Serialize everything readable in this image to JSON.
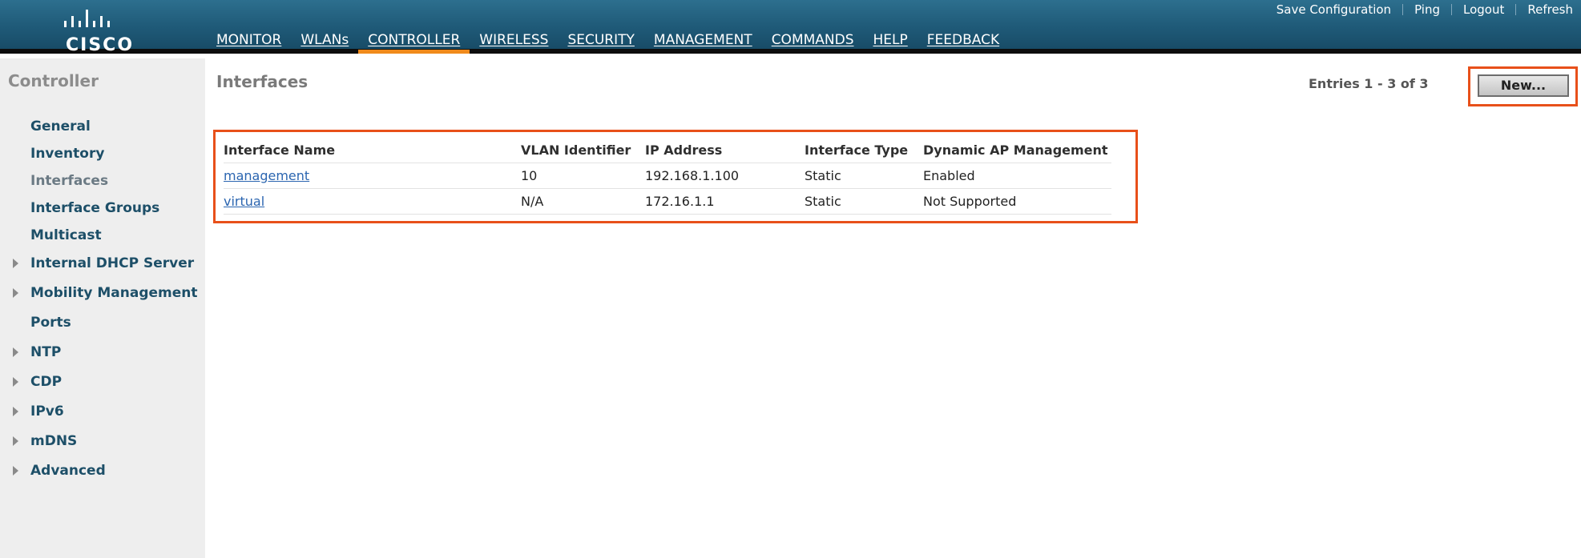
{
  "header": {
    "brand": "CISCO",
    "top_links": [
      "Save Configuration",
      "Ping",
      "Logout",
      "Refresh"
    ],
    "nav": [
      {
        "label": "MONITOR",
        "active": false
      },
      {
        "label": "WLANs",
        "active": false
      },
      {
        "label": "CONTROLLER",
        "active": true
      },
      {
        "label": "WIRELESS",
        "active": false
      },
      {
        "label": "SECURITY",
        "active": false
      },
      {
        "label": "MANAGEMENT",
        "active": false
      },
      {
        "label": "COMMANDS",
        "active": false
      },
      {
        "label": "HELP",
        "active": false
      },
      {
        "label": "FEEDBACK",
        "active": false
      }
    ]
  },
  "sidebar": {
    "title": "Controller",
    "items": [
      {
        "label": "General",
        "expandable": false,
        "active": false
      },
      {
        "label": "Inventory",
        "expandable": false,
        "active": false
      },
      {
        "label": "Interfaces",
        "expandable": false,
        "active": true
      },
      {
        "label": "Interface Groups",
        "expandable": false,
        "active": false
      },
      {
        "label": "Multicast",
        "expandable": false,
        "active": false
      },
      {
        "label": "Internal DHCP Server",
        "expandable": true,
        "active": false
      },
      {
        "label": "Mobility Management",
        "expandable": true,
        "active": false
      },
      {
        "label": "Ports",
        "expandable": false,
        "active": false
      },
      {
        "label": "NTP",
        "expandable": true,
        "active": false
      },
      {
        "label": "CDP",
        "expandable": true,
        "active": false
      },
      {
        "label": "IPv6",
        "expandable": true,
        "active": false
      },
      {
        "label": "mDNS",
        "expandable": true,
        "active": false
      },
      {
        "label": "Advanced",
        "expandable": true,
        "active": false
      }
    ]
  },
  "main": {
    "title": "Interfaces",
    "entries": "Entries 1 - 3 of 3",
    "new_button": "New...",
    "table": {
      "headers": [
        "Interface Name",
        "VLAN Identifier",
        "IP Address",
        "Interface Type",
        "Dynamic AP Management"
      ],
      "rows": [
        [
          "management",
          "10",
          "192.168.1.100",
          "Static",
          "Enabled"
        ],
        [
          "virtual",
          "N/A",
          "172.16.1.1",
          "Static",
          "Not Supported"
        ]
      ]
    }
  },
  "colors": {
    "header_bg": "#1f5a78",
    "active_tab_underline": "#f08a1c",
    "highlight_frame": "#e8501a",
    "sidebar_bg": "#eeeeee",
    "sidebar_link": "#1d4f68",
    "link": "#2b65b0"
  }
}
